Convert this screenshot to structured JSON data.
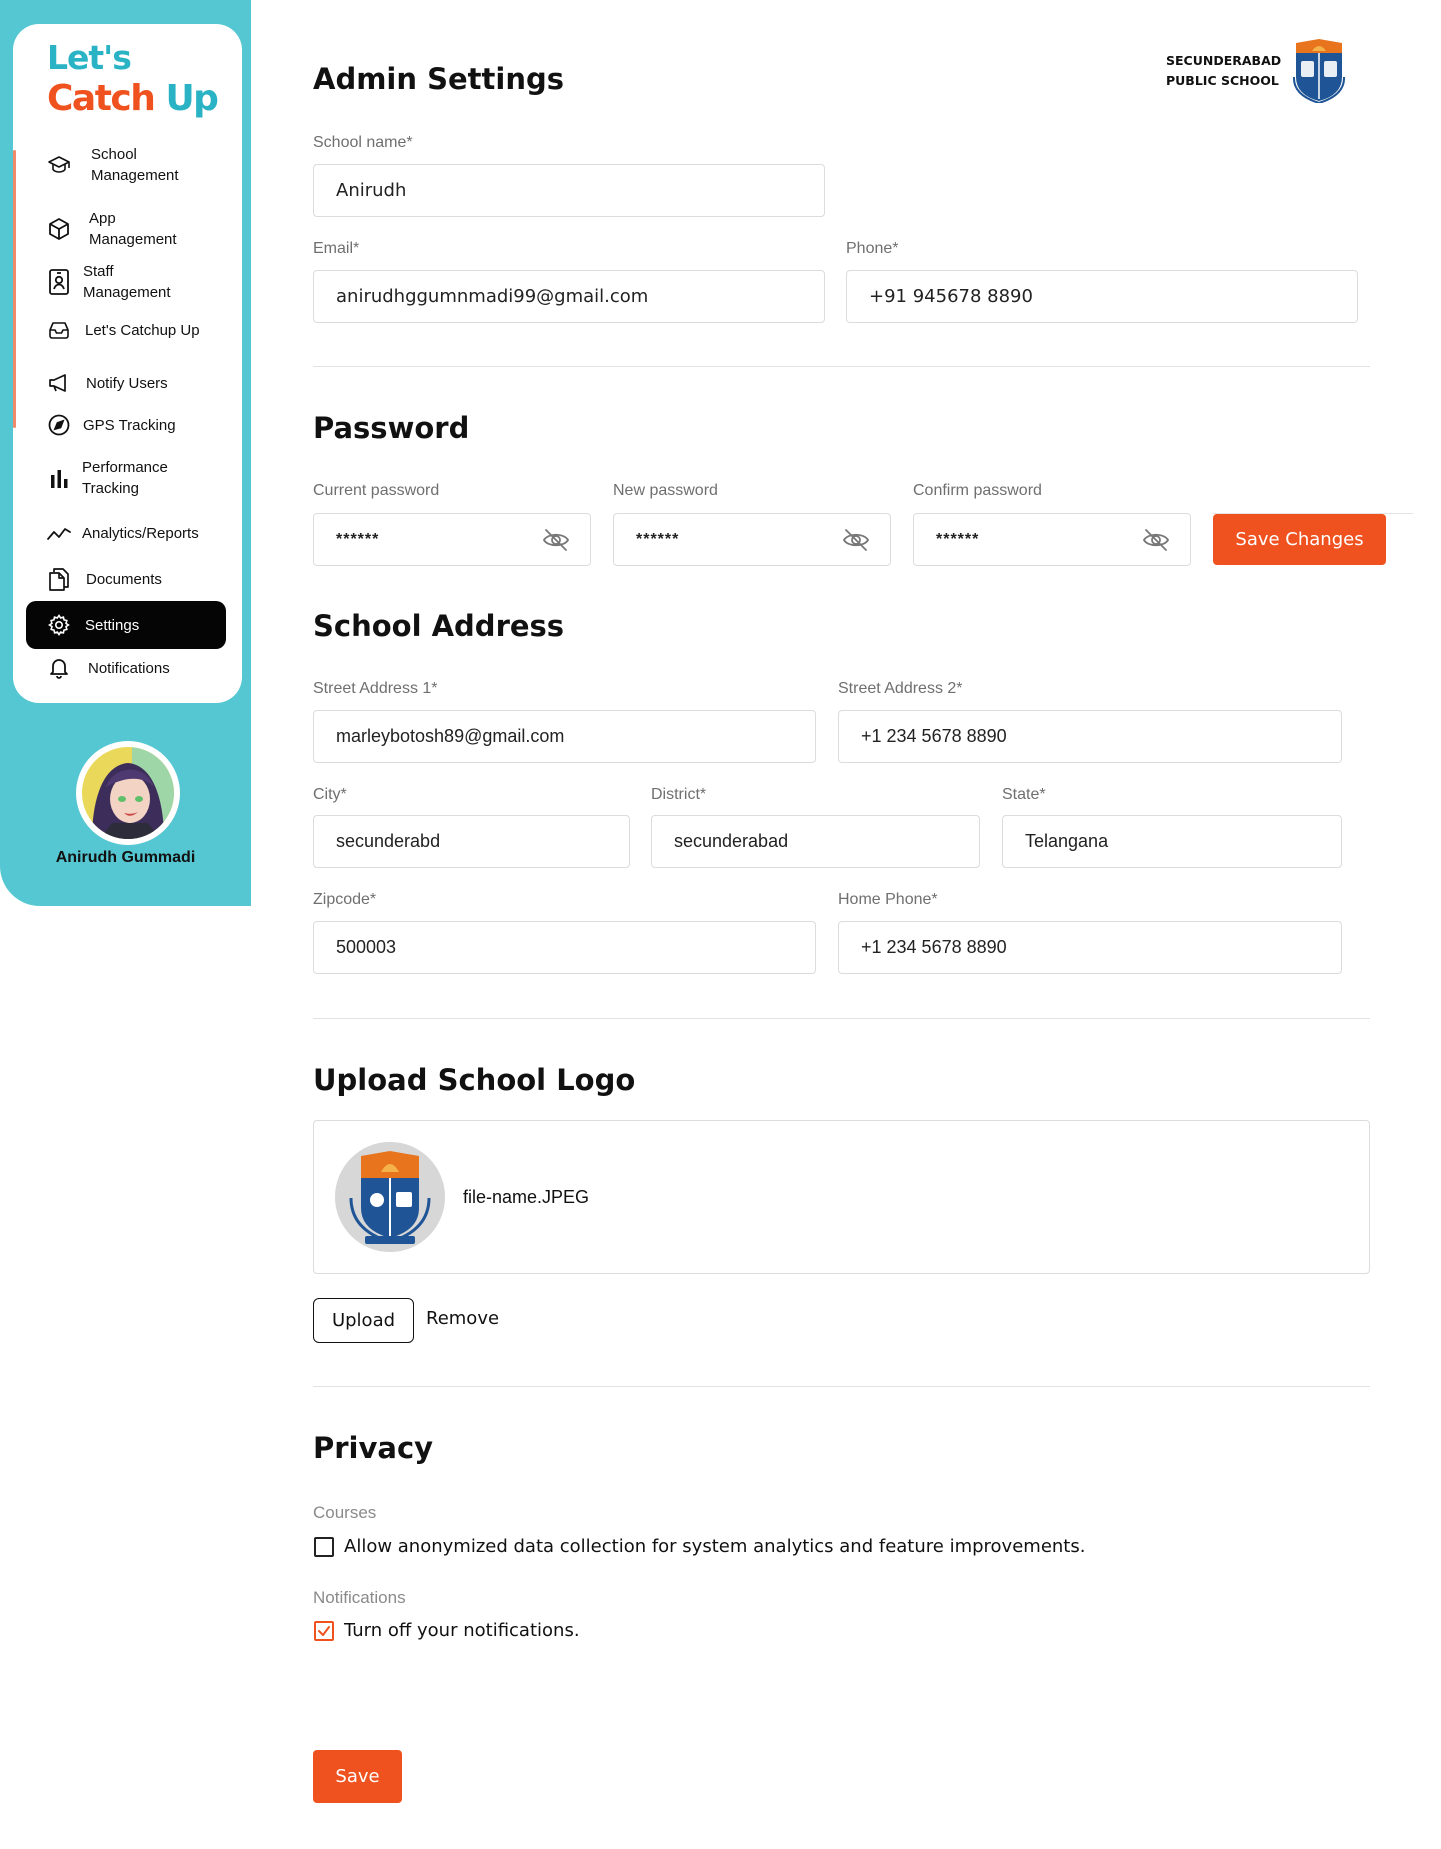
{
  "app": {
    "logo_line1": "Let's",
    "logo_catch": "Catch",
    "logo_up": "Up"
  },
  "colors": {
    "accent": "#f0521f",
    "sidebar_bg": "#55c7d2",
    "brand_teal": "#2ab3c4",
    "active_nav": "#050505"
  },
  "sidebar": {
    "items": [
      {
        "label": "School\nManagement",
        "icon": "graduation-cap-icon"
      },
      {
        "label": "App\nManagement",
        "icon": "cube-icon"
      },
      {
        "label": "Staff\nManagement",
        "icon": "id-badge-icon"
      },
      {
        "label": "Let's Catchup Up",
        "icon": "inbox-icon"
      },
      {
        "label": "Notify Users",
        "icon": "megaphone-icon"
      },
      {
        "label": "GPS Tracking",
        "icon": "compass-icon"
      },
      {
        "label": "Performance\nTracking",
        "icon": "bar-chart-icon"
      },
      {
        "label": "Analytics/Reports",
        "icon": "trend-line-icon"
      },
      {
        "label": "Documents",
        "icon": "documents-icon"
      },
      {
        "label": "Settings",
        "icon": "gear-icon",
        "active": true
      },
      {
        "label": "Notifications",
        "icon": "bell-icon"
      }
    ],
    "user_name": "Anirudh Gummadi"
  },
  "brand": {
    "school_name": "SECUNDERABAD\nPUBLIC SCHOOL"
  },
  "admin": {
    "title": "Admin Settings",
    "school_name_label": "School name*",
    "school_name_value": "Anirudh",
    "email_label": "Email*",
    "email_value": "anirudhggumnmadi99@gmail.com",
    "phone_label": "Phone*",
    "phone_value": "+91 945678 8890"
  },
  "password": {
    "title": "Password",
    "current_label": "Current password",
    "current_value": "******",
    "new_label": "New password",
    "new_value": "******",
    "confirm_label": "Confirm password",
    "confirm_value": "******",
    "save_changes": "Save Changes"
  },
  "address": {
    "title": "School Address",
    "street1_label": "Street Address 1*",
    "street1_value": "marleybotosh89@gmail.com",
    "street2_label": "Street Address 2*",
    "street2_value": "+1 234 5678 8890",
    "city_label": "City*",
    "city_value": "secunderabd",
    "district_label": "District*",
    "district_value": "secunderabad",
    "state_label": "State*",
    "state_value": "Telangana",
    "zip_label": "Zipcode*",
    "zip_value": "500003",
    "homephone_label": "Home Phone*",
    "homephone_value": "+1 234 5678 8890"
  },
  "logo_upload": {
    "title": "Upload School Logo",
    "file_name": "file-name.JPEG",
    "upload": "Upload",
    "remove": "Remove"
  },
  "privacy": {
    "title": "Privacy",
    "courses_label": "Courses",
    "courses_option": "Allow anonymized data collection for system analytics and feature improvements.",
    "courses_checked": false,
    "notifications_label": "Notifications",
    "notifications_option": "Turn off your notifications.",
    "notifications_checked": true
  },
  "footer": {
    "save": "Save"
  }
}
